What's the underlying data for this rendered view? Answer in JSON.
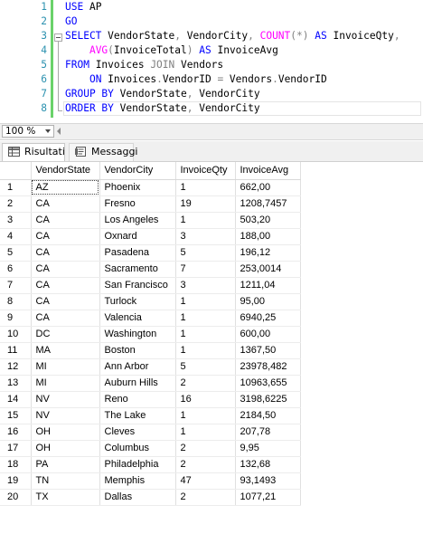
{
  "editor": {
    "line_numbers": [
      "1",
      "2",
      "3",
      "4",
      "5",
      "6",
      "7",
      "8"
    ],
    "lines": [
      [
        {
          "t": "USE",
          "c": "kw"
        },
        {
          "t": " AP",
          "c": ""
        }
      ],
      [
        {
          "t": "GO",
          "c": "kw"
        }
      ],
      [
        {
          "t": "SELECT",
          "c": "kw"
        },
        {
          "t": " VendorState",
          "c": ""
        },
        {
          "t": ",",
          "c": "gr"
        },
        {
          "t": " VendorCity",
          "c": ""
        },
        {
          "t": ",",
          "c": "gr"
        },
        {
          "t": " ",
          "c": ""
        },
        {
          "t": "COUNT",
          "c": "fn"
        },
        {
          "t": "(*)",
          "c": "gr"
        },
        {
          "t": " ",
          "c": ""
        },
        {
          "t": "AS",
          "c": "kw"
        },
        {
          "t": " InvoiceQty",
          "c": ""
        },
        {
          "t": ",",
          "c": "gr"
        }
      ],
      [
        {
          "t": "    ",
          "c": ""
        },
        {
          "t": "AVG",
          "c": "fn"
        },
        {
          "t": "(",
          "c": "gr"
        },
        {
          "t": "InvoiceTotal",
          "c": ""
        },
        {
          "t": ")",
          "c": "gr"
        },
        {
          "t": " ",
          "c": ""
        },
        {
          "t": "AS",
          "c": "kw"
        },
        {
          "t": " InvoiceAvg",
          "c": ""
        }
      ],
      [
        {
          "t": "FROM",
          "c": "kw"
        },
        {
          "t": " Invoices ",
          "c": ""
        },
        {
          "t": "JOIN",
          "c": "gr"
        },
        {
          "t": " Vendors",
          "c": ""
        }
      ],
      [
        {
          "t": "    ",
          "c": ""
        },
        {
          "t": "ON",
          "c": "kw"
        },
        {
          "t": " Invoices",
          "c": ""
        },
        {
          "t": ".",
          "c": "gr"
        },
        {
          "t": "VendorID ",
          "c": ""
        },
        {
          "t": "=",
          "c": "gr"
        },
        {
          "t": " Vendors",
          "c": ""
        },
        {
          "t": ".",
          "c": "gr"
        },
        {
          "t": "VendorID",
          "c": ""
        }
      ],
      [
        {
          "t": "GROUP BY",
          "c": "kw"
        },
        {
          "t": " VendorState",
          "c": ""
        },
        {
          "t": ",",
          "c": "gr"
        },
        {
          "t": " VendorCity",
          "c": ""
        }
      ],
      [
        {
          "t": "ORDER BY",
          "c": "kw"
        },
        {
          "t": " VendorState",
          "c": ""
        },
        {
          "t": ",",
          "c": "gr"
        },
        {
          "t": " VendorCity",
          "c": ""
        }
      ]
    ]
  },
  "zoom": {
    "value": "100 %"
  },
  "tabs": {
    "results": "Risultati",
    "messages": "Messaggi"
  },
  "grid": {
    "columns": [
      "VendorState",
      "VendorCity",
      "InvoiceQty",
      "InvoiceAvg"
    ],
    "rows": [
      [
        "1",
        "AZ",
        "Phoenix",
        "1",
        "662,00"
      ],
      [
        "2",
        "CA",
        "Fresno",
        "19",
        "1208,7457"
      ],
      [
        "3",
        "CA",
        "Los Angeles",
        "1",
        "503,20"
      ],
      [
        "4",
        "CA",
        "Oxnard",
        "3",
        "188,00"
      ],
      [
        "5",
        "CA",
        "Pasadena",
        "5",
        "196,12"
      ],
      [
        "6",
        "CA",
        "Sacramento",
        "7",
        "253,0014"
      ],
      [
        "7",
        "CA",
        "San Francisco",
        "3",
        "1211,04"
      ],
      [
        "8",
        "CA",
        "Turlock",
        "1",
        "95,00"
      ],
      [
        "9",
        "CA",
        "Valencia",
        "1",
        "6940,25"
      ],
      [
        "10",
        "DC",
        "Washington",
        "1",
        "600,00"
      ],
      [
        "11",
        "MA",
        "Boston",
        "1",
        "1367,50"
      ],
      [
        "12",
        "MI",
        "Ann Arbor",
        "5",
        "23978,482"
      ],
      [
        "13",
        "MI",
        "Auburn Hills",
        "2",
        "10963,655"
      ],
      [
        "14",
        "NV",
        "Reno",
        "16",
        "3198,6225"
      ],
      [
        "15",
        "NV",
        "The Lake",
        "1",
        "2184,50"
      ],
      [
        "16",
        "OH",
        "Cleves",
        "1",
        "207,78"
      ],
      [
        "17",
        "OH",
        "Columbus",
        "2",
        "9,95"
      ],
      [
        "18",
        "PA",
        "Philadelphia",
        "2",
        "132,68"
      ],
      [
        "19",
        "TN",
        "Memphis",
        "47",
        "93,1493"
      ],
      [
        "20",
        "TX",
        "Dallas",
        "2",
        "1077,21"
      ]
    ]
  },
  "colors": {
    "keyword": "#0000ff",
    "function": "#ff00ff",
    "operator": "#808080",
    "line_number": "#2b91af",
    "change_bar": "#6ad26a"
  }
}
